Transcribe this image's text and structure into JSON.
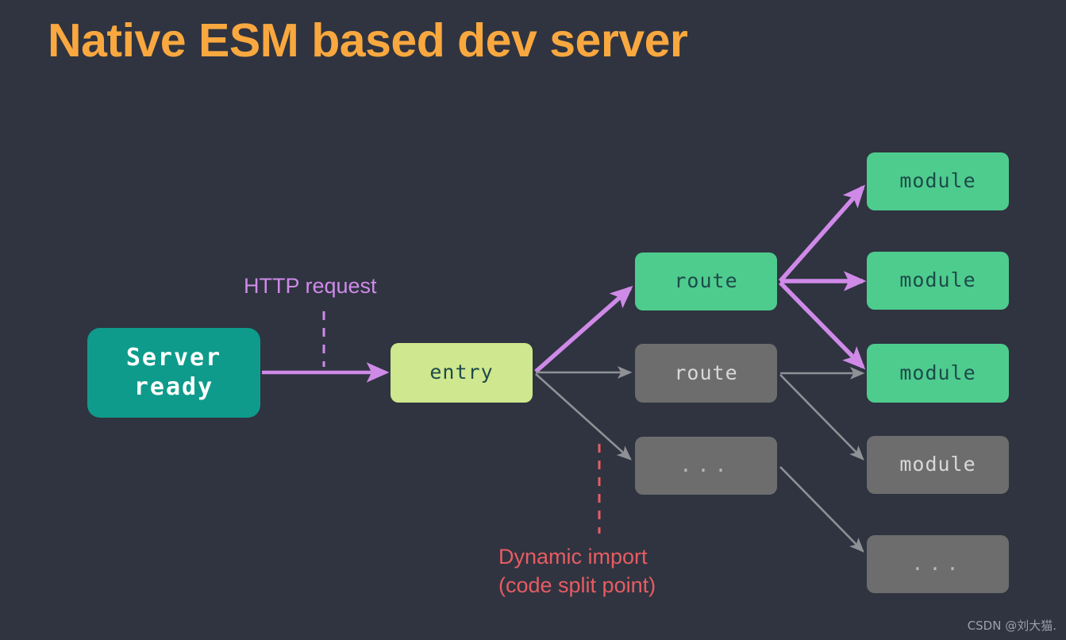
{
  "page": {
    "title": "Native ESM based dev server",
    "background_color": "#2f3440",
    "title_color": "#f9a83f",
    "watermark": "CSDN @刘大猫."
  },
  "palette": {
    "active_edge": "#cf8ae8",
    "inactive_edge": "#8f9196",
    "teal": "#0f9b8b",
    "entry_green": "#cfe78e",
    "module_green": "#4ecc8e",
    "dim_gray": "#6d6d6d",
    "dynamic_red": "#e85c62"
  },
  "annotations": {
    "http_request": "HTTP request",
    "dynamic_import": "Dynamic import\n(code split point)"
  },
  "nodes": {
    "server": {
      "label": "Server\nready",
      "state": "active"
    },
    "entry": {
      "label": "entry",
      "state": "entry"
    },
    "route_active": {
      "label": "route",
      "state": "active"
    },
    "route_dim": {
      "label": "route",
      "state": "dim"
    },
    "route_ellipsis": {
      "label": "...",
      "state": "dim"
    },
    "module_1": {
      "label": "module",
      "state": "active"
    },
    "module_2": {
      "label": "module",
      "state": "active"
    },
    "module_3": {
      "label": "module",
      "state": "active"
    },
    "module_4": {
      "label": "module",
      "state": "dim"
    },
    "module_ellipsis": {
      "label": "...",
      "state": "dim"
    }
  }
}
